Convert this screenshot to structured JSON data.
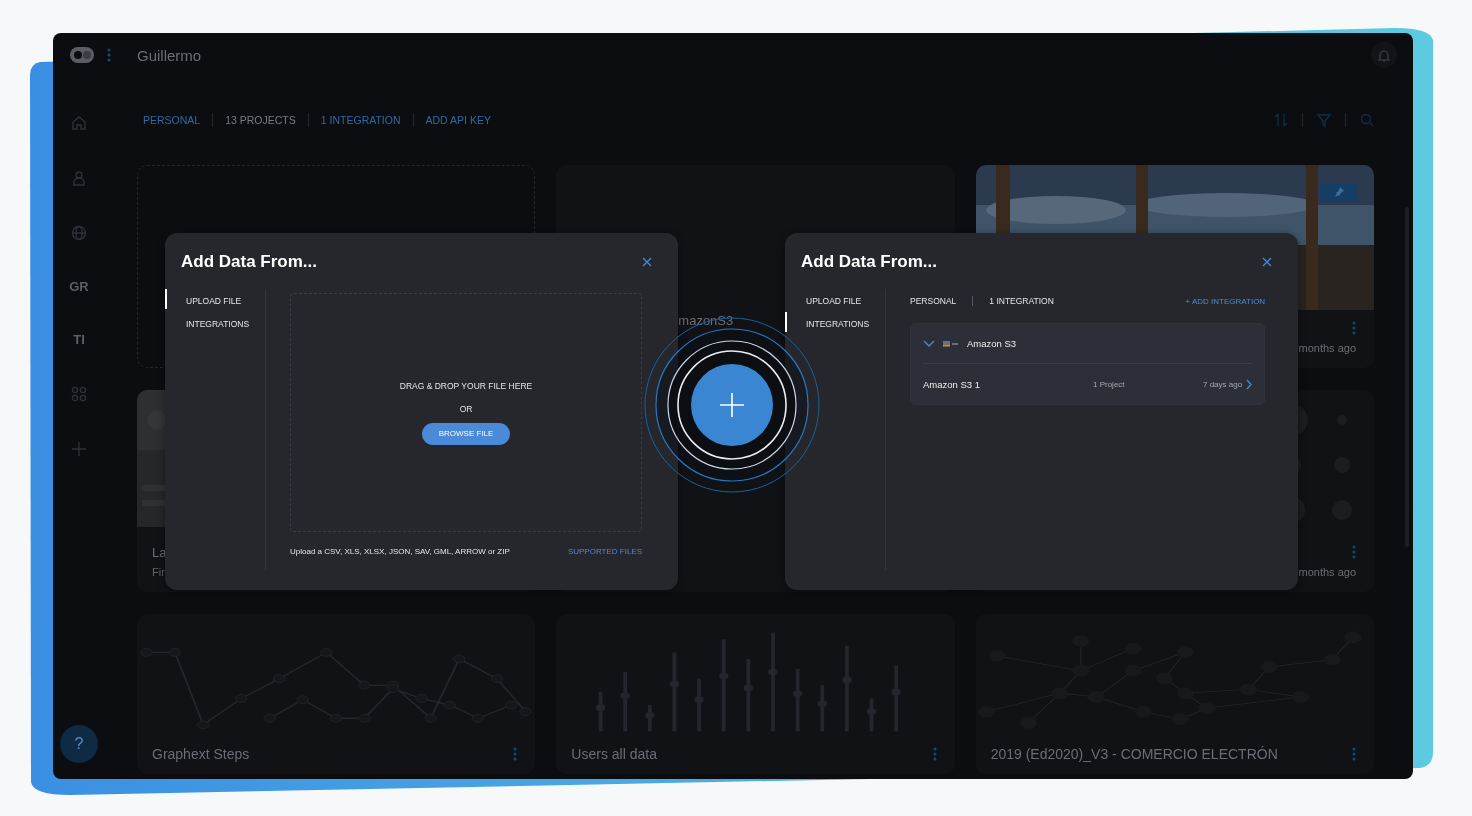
{
  "app": {
    "user": "Guillermo"
  },
  "sidebar": {
    "initials": [
      "GR",
      "TI"
    ],
    "help": "?"
  },
  "tabs": [
    {
      "label": "PERSONAL",
      "kind": "link"
    },
    {
      "label": "13 PROJECTS",
      "kind": "count"
    },
    {
      "label": "1 INTEGRATION",
      "kind": "link"
    },
    {
      "label": "ADD API KEY",
      "kind": "link"
    }
  ],
  "cards": [
    {
      "kind": "new"
    },
    {
      "kind": "plain",
      "title": "mazonS3"
    },
    {
      "meta": "months ago",
      "menu": true,
      "pinned": true
    },
    {
      "kind": "cover",
      "title": "La",
      "subtitle": "Fir"
    },
    {
      "kind": "plain"
    },
    {
      "kind": "dots",
      "meta": "months ago",
      "menu": true
    },
    {
      "kind": "line",
      "title": "Graphext Steps",
      "menu": true
    },
    {
      "kind": "bars",
      "title": "Users all data",
      "menu": true
    },
    {
      "kind": "network",
      "title": "2019 (Ed2020)_V3 - COMERCIO ELECTRÓN",
      "menu": true
    }
  ],
  "modals": [
    {
      "kind": "upload",
      "title": "Add Data From...",
      "nav": [
        {
          "label": "UPLOAD FILE",
          "selected": true
        },
        {
          "label": "INTEGRATIONS",
          "selected": false
        }
      ],
      "dropzone": {
        "prompt": "DRAG & DROP YOUR FILE HERE",
        "or": "OR",
        "button": "BROWSE FILE"
      },
      "note": "Upload a CSV, XLS, XLSX, JSON, SAV, GML, ARROW or ZIP",
      "link": "SUPPORTED FILES"
    },
    {
      "kind": "integrations",
      "title": "Add Data From...",
      "nav": [
        {
          "label": "UPLOAD FILE",
          "selected": false
        },
        {
          "label": "INTEGRATIONS",
          "selected": true
        }
      ],
      "filters": [
        "PERSONAL",
        "1 INTEGRATION"
      ],
      "add_link": "+ ADD INTEGRATION",
      "groups": [
        {
          "name": "Amazon S3",
          "expanded": true,
          "items": [
            {
              "name": "Amazon S3 1",
              "projects": "1 Project",
              "updated": "7 days ago"
            }
          ]
        }
      ]
    }
  ]
}
